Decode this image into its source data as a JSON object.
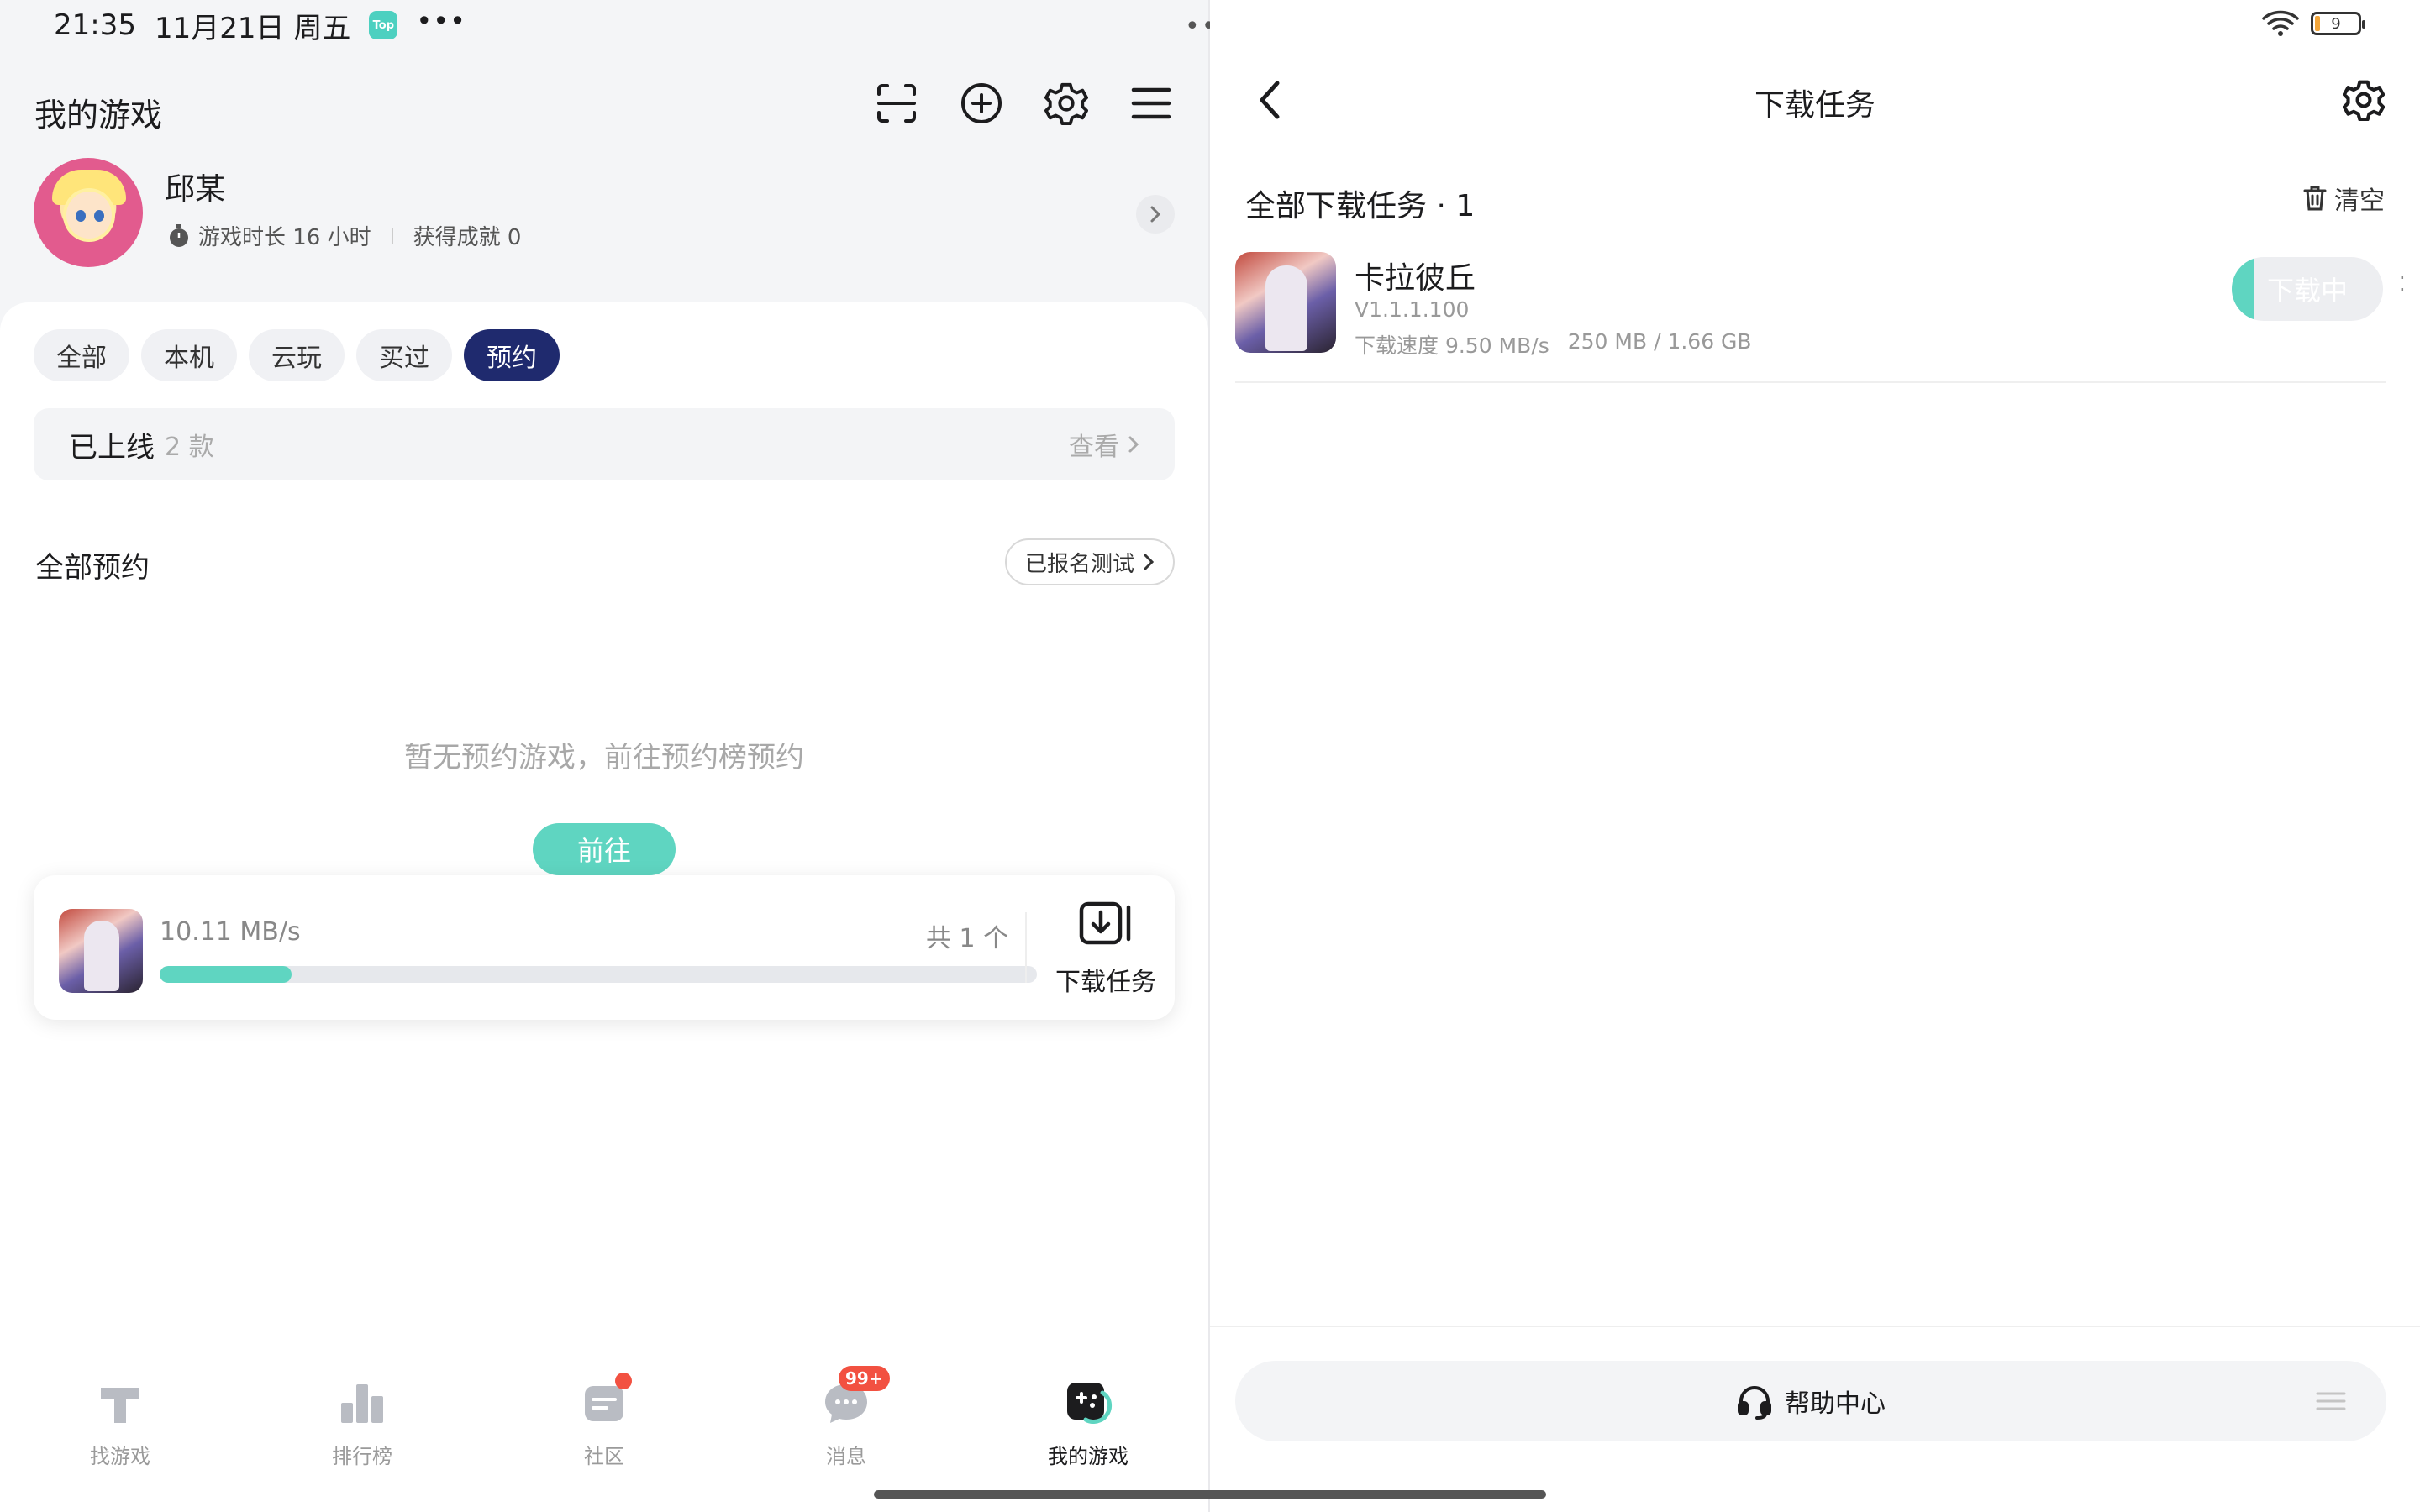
{
  "status": {
    "time": "21:35",
    "date": "11月21日 周五",
    "app_badge": "Top",
    "more": "•••",
    "battery": "9",
    "multitask_dots": "•••"
  },
  "left": {
    "title": "我的游戏",
    "profile": {
      "name": "邱某",
      "play_time": "游戏时长 16 小时",
      "achievements": "获得成就 0"
    },
    "filters": [
      "全部",
      "本机",
      "云玩",
      "买过",
      "预约"
    ],
    "active_filter": "预约",
    "online": {
      "label": "已上线",
      "count": "2 款",
      "view": "查看"
    },
    "section_title": "全部预约",
    "signed_test": "已报名测试",
    "empty_text": "暂无预约游戏，前往预约榜预约",
    "goto_label": "前往",
    "download_card": {
      "speed": "10.11 MB/s",
      "count": "共 1 个",
      "progress": 0.15,
      "task_label": "下载任务"
    },
    "tabs": [
      {
        "label": "找游戏",
        "icon": "find-game-icon"
      },
      {
        "label": "排行榜",
        "icon": "ranking-icon"
      },
      {
        "label": "社区",
        "icon": "community-icon"
      },
      {
        "label": "消息",
        "icon": "message-icon",
        "badge": "99+"
      },
      {
        "label": "我的游戏",
        "icon": "my-games-icon"
      }
    ]
  },
  "right": {
    "title": "下载任务",
    "section": "全部下载任务 · 1",
    "clear": "清空",
    "task": {
      "name": "卡拉彼丘",
      "version": "V1.1.1.100",
      "speed": "下载速度 9.50 MB/s",
      "size": "250 MB / 1.66 GB",
      "button": "下载中",
      "progress": 0.15
    },
    "help": "帮助中心"
  },
  "colors": {
    "accent": "#5fd5c1",
    "active_chip": "#1f2a6e",
    "badge": "#f25141"
  }
}
